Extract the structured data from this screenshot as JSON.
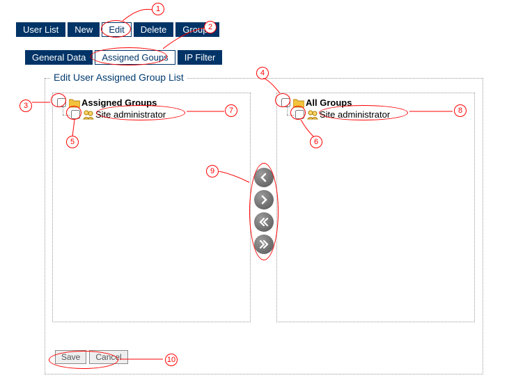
{
  "tabs_top": {
    "user_list": "User List",
    "new": "New",
    "edit": "Edit",
    "delete": "Delete",
    "groups": "Groups"
  },
  "tabs_sub": {
    "general_data": "General Data",
    "assigned_groups": "Assigned Goups",
    "ip_filter": "IP Filter"
  },
  "panel_title": "Edit User Assigned Group List",
  "left_tree": {
    "root": "Assigned Groups",
    "child": "Site administrator"
  },
  "right_tree": {
    "root": "All Groups",
    "child": "Site administrator"
  },
  "actions": {
    "save": "Save",
    "cancel": "Cancel"
  },
  "annotations": {
    "n1": "1",
    "n2": "2",
    "n3": "3",
    "n4": "4",
    "n5": "5",
    "n6": "6",
    "n7": "7",
    "n8": "8",
    "n9": "9",
    "n10": "10"
  }
}
